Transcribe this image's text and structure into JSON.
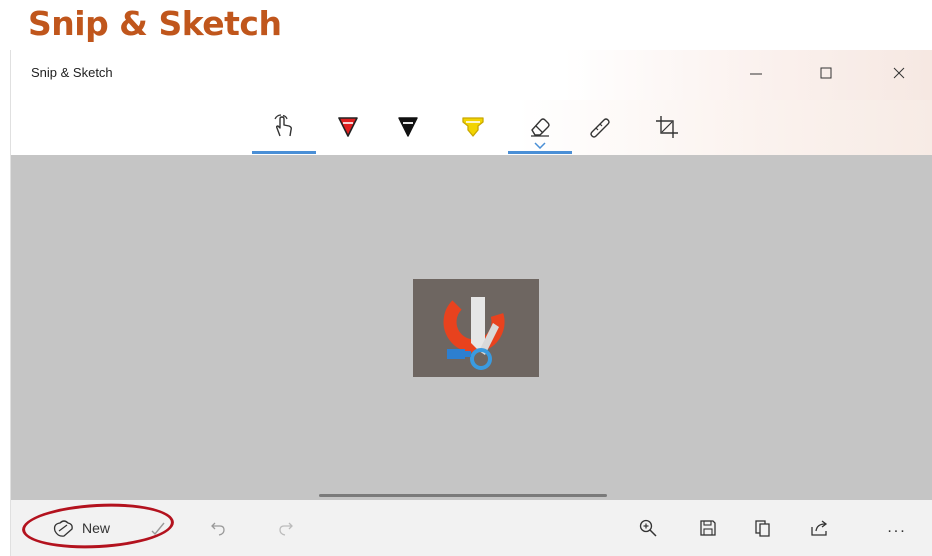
{
  "caption": {
    "text": "Snip & Sketch"
  },
  "window": {
    "title": "Snip & Sketch",
    "controls": [
      "minimize-icon",
      "maximize-icon",
      "close-icon"
    ]
  },
  "toolbar": {
    "tools": [
      {
        "name": "touch-writing-icon",
        "active": true
      },
      {
        "name": "ballpoint-pen-icon",
        "color": "#e02020"
      },
      {
        "name": "pencil-icon",
        "color": "#111111"
      },
      {
        "name": "highlighter-icon",
        "color": "#f2d400"
      },
      {
        "name": "eraser-icon",
        "active": true,
        "has_dropdown": true
      },
      {
        "name": "ruler-icon"
      },
      {
        "name": "crop-icon"
      }
    ],
    "accent": "#4a8fd6"
  },
  "snip": {
    "name": "snip-and-sketch-logo"
  },
  "bottombar": {
    "new_label": "New",
    "buttons": [
      "new-snip-icon",
      "check-icon",
      "undo-icon",
      "redo-icon",
      "zoom-in-icon",
      "save-icon",
      "copy-icon",
      "share-icon",
      "more-icon"
    ],
    "more_label": "..."
  },
  "colors": {
    "caption": "#c0561c",
    "annotation_ring": "#b3121e",
    "canvas": "#c5c5c5"
  }
}
